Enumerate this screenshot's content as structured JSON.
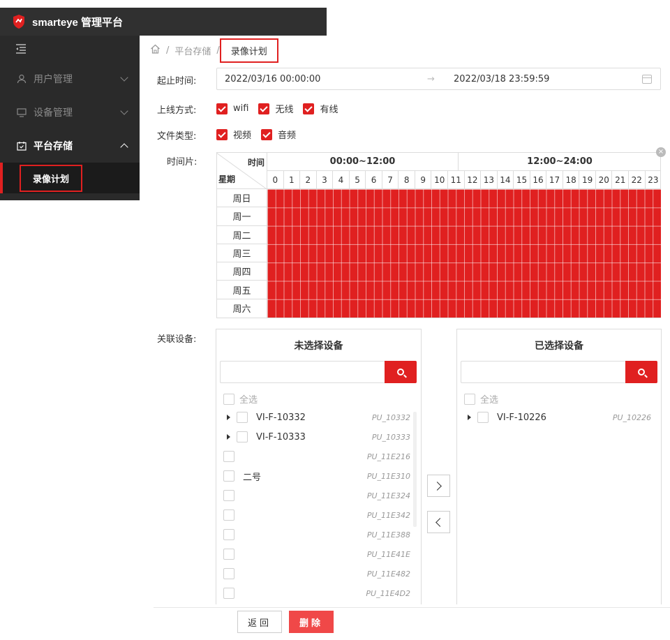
{
  "app": {
    "title": "smarteye 管理平台"
  },
  "sidebar": {
    "items": [
      {
        "label": "用户管理"
      },
      {
        "label": "设备管理"
      },
      {
        "label": "平台存储"
      }
    ],
    "sub_item": "录像计划"
  },
  "breadcrumb": {
    "parent": "平台存储",
    "sep": "/",
    "current": "录像计划"
  },
  "form": {
    "time_range_label": "起止时间:",
    "start": "2022/03/16 00:00:00",
    "arrow": "→",
    "end": "2022/03/18 23:59:59",
    "online_label": "上线方式:",
    "online_options": [
      "wifi",
      "无线",
      "有线"
    ],
    "filetype_label": "文件类型:",
    "filetype_options": [
      "视频",
      "音频"
    ],
    "timeslot_label": "时间片:",
    "device_label": "关联设备:"
  },
  "schedule": {
    "corner_top": "时间",
    "corner_bottom": "星期",
    "half1": "00:00~12:00",
    "half2": "12:00~24:00",
    "hours": [
      "0",
      "1",
      "2",
      "3",
      "4",
      "5",
      "6",
      "7",
      "8",
      "9",
      "10",
      "11",
      "12",
      "13",
      "14",
      "15",
      "16",
      "17",
      "18",
      "19",
      "20",
      "21",
      "22",
      "23"
    ],
    "days": [
      "周日",
      "周一",
      "周二",
      "周三",
      "周四",
      "周五",
      "周六"
    ],
    "all_selected": true,
    "selected_color": "#e02020"
  },
  "unselected": {
    "title": "未选择设备",
    "select_all": "全选",
    "items": [
      {
        "name": "VI-F-10332",
        "code": "PU_10332",
        "expandable": true
      },
      {
        "name": "VI-F-10333",
        "code": "PU_10333",
        "expandable": true
      },
      {
        "name": "",
        "code": "PU_11E216",
        "expandable": false
      },
      {
        "name": "二号",
        "code": "PU_11E310",
        "expandable": false
      },
      {
        "name": "",
        "code": "PU_11E324",
        "expandable": false
      },
      {
        "name": "",
        "code": "PU_11E342",
        "expandable": false
      },
      {
        "name": "",
        "code": "PU_11E388",
        "expandable": false
      },
      {
        "name": "",
        "code": "PU_11E41E",
        "expandable": false
      },
      {
        "name": "",
        "code": "PU_11E482",
        "expandable": false
      },
      {
        "name": "",
        "code": "PU_11E4D2",
        "expandable": false
      }
    ]
  },
  "selected": {
    "title": "已选择设备",
    "select_all": "全选",
    "items": [
      {
        "name": "VI-F-10226",
        "code": "PU_10226",
        "expandable": true
      }
    ]
  },
  "footer": {
    "back": "返回",
    "delete": "删除"
  },
  "colors": {
    "accent": "#e02020",
    "topbar": "#303030",
    "sidebar": "#2a2a2a"
  }
}
